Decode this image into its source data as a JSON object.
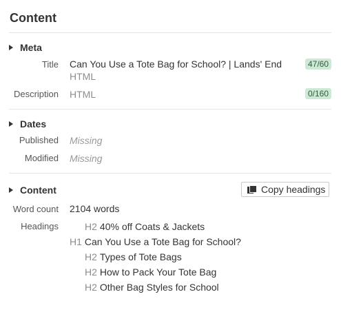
{
  "page_title": "Content",
  "meta": {
    "section_label": "Meta",
    "title_label": "Title",
    "title_value": "Can You Use a Tote Bag for School? | Lands' End",
    "title_source": "HTML",
    "title_count": "47/60",
    "description_label": "Description",
    "description_source": "HTML",
    "description_count": "0/160"
  },
  "dates": {
    "section_label": "Dates",
    "published_label": "Published",
    "published_value": "Missing",
    "modified_label": "Modified",
    "modified_value": "Missing"
  },
  "content": {
    "section_label": "Content",
    "copy_button_label": "Copy headings",
    "word_count_label": "Word count",
    "word_count_value": "2104 words",
    "headings_label": "Headings",
    "headings": [
      {
        "level": "H2",
        "text": "40% off Coats & Jackets"
      },
      {
        "level": "H1",
        "text": "Can You Use a Tote Bag for School?"
      },
      {
        "level": "H2",
        "text": "Types of Tote Bags"
      },
      {
        "level": "H2",
        "text": "How to Pack Your Tote Bag"
      },
      {
        "level": "H2",
        "text": "Other Bag Styles for School"
      }
    ]
  },
  "colors": {
    "badge_bg": "#cde9d6",
    "badge_text": "#2f5d3a",
    "divider": "#e4e4e4"
  }
}
